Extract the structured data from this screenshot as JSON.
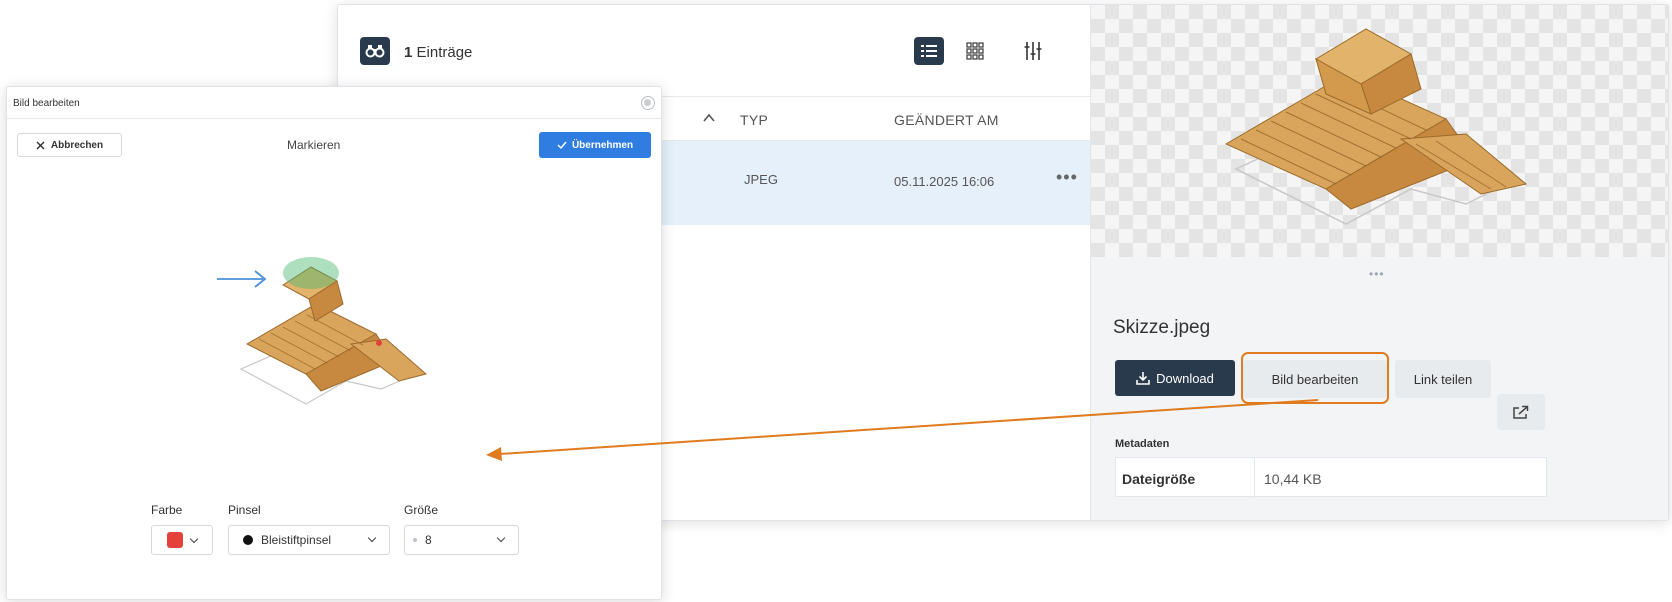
{
  "file_manager": {
    "entries_count": "1",
    "entries_label": "Einträge",
    "icons": {
      "entries": "binoculars-icon",
      "list_view": "list-view-icon",
      "grid_view": "grid-view-icon",
      "filter": "filter-sliders-icon"
    },
    "columns": {
      "type": "TYP",
      "modified": "GEÄNDERT AM"
    },
    "rows": [
      {
        "type": "JPEG",
        "modified": "05.11.2025 16:06"
      }
    ],
    "row_more": "•••"
  },
  "preview": {
    "handle": "•••",
    "file_name": "Skizze.jpeg",
    "download_label": "Download",
    "edit_label": "Bild bearbeiten",
    "share_label": "Link teilen",
    "metadata_title": "Metadaten",
    "metadata": [
      {
        "key": "Dateigröße",
        "value": "10,44 KB"
      }
    ]
  },
  "edit_dialog": {
    "title": "Bild bearbeiten",
    "cancel_label": "Abbrechen",
    "mode_label": "Markieren",
    "apply_label": "Übernehmen",
    "color_label": "Farbe",
    "color_value": "#e5413b",
    "brush_label": "Pinsel",
    "brush_value": "Bleistiftpinsel",
    "size_label": "Größe",
    "size_value": "8"
  },
  "colors": {
    "primary_dark": "#2a3a4d",
    "accent_blue": "#2f7de1",
    "highlight_orange": "#e07b1f",
    "selected_row": "#e6f0fb"
  }
}
